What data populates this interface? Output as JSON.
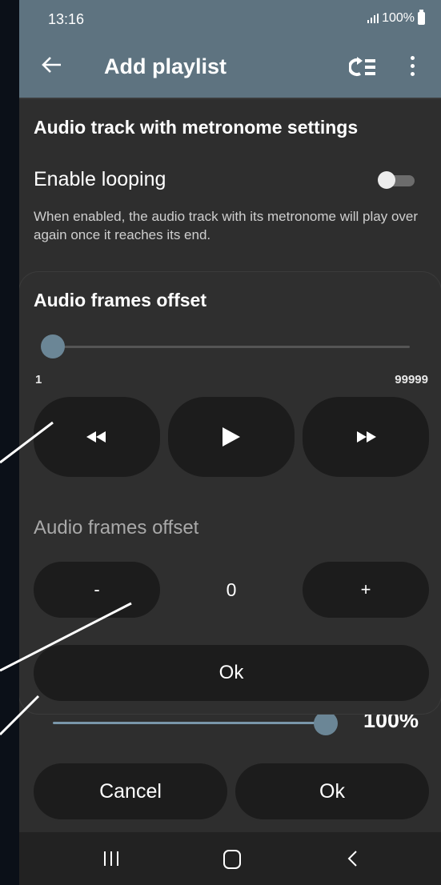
{
  "status_bar": {
    "time": "13:16",
    "battery": "100%"
  },
  "toolbar": {
    "title": "Add playlist",
    "back_icon": "arrow-left-icon",
    "loop_icon": "playlist-loop-icon",
    "more_icon": "more-vertical-icon"
  },
  "settings": {
    "section_title": "Audio track with metronome settings",
    "enable_looping_label": "Enable looping",
    "enable_looping_value": false,
    "enable_looping_description": "When enabled, the audio track with its metronome will play over again once it reaches its end."
  },
  "behind_dialog": {
    "volume_percent": "100%",
    "volume_fraction": 0.95,
    "cancel_label": "Cancel",
    "ok_label": "Ok"
  },
  "dialog": {
    "title": "Audio frames offset",
    "slider_value_fraction": 0.0,
    "range_min": "1",
    "range_max": "99999",
    "rewind_icon": "rewind-icon",
    "play_icon": "play-icon",
    "fast_forward_icon": "fast-forward-icon",
    "offset_label": "Audio frames offset",
    "decrement_label": "-",
    "offset_value": "0",
    "increment_label": "+",
    "ok_label": "Ok"
  },
  "nav_bar": {
    "recents_icon": "recents-icon",
    "home_icon": "home-icon",
    "back_icon": "back-chevron-icon"
  },
  "colors": {
    "toolbar": "#5e7380",
    "sheet": "#2e2e2e",
    "button": "#1c1c1c",
    "slider_thumb": "#6b8696",
    "background": "#0b1018"
  }
}
